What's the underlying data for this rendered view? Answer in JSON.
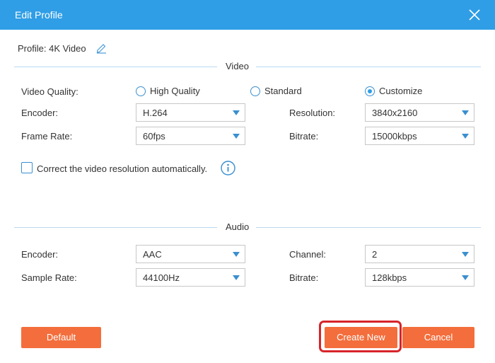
{
  "window": {
    "title": "Edit Profile"
  },
  "profile": {
    "label": "Profile:",
    "value": "4K Video"
  },
  "video": {
    "section_title": "Video",
    "quality_label": "Video Quality:",
    "quality_options": [
      {
        "label": "High Quality",
        "selected": false
      },
      {
        "label": "Standard",
        "selected": false
      },
      {
        "label": "Customize",
        "selected": true
      }
    ],
    "encoder_label": "Encoder:",
    "encoder_value": "H.264",
    "resolution_label": "Resolution:",
    "resolution_value": "3840x2160",
    "frame_rate_label": "Frame Rate:",
    "frame_rate_value": "60fps",
    "bitrate_label": "Bitrate:",
    "bitrate_value": "15000kbps",
    "auto_resolution_label": "Correct the video resolution automatically.",
    "auto_resolution_checked": false
  },
  "audio": {
    "section_title": "Audio",
    "encoder_label": "Encoder:",
    "encoder_value": "AAC",
    "channel_label": "Channel:",
    "channel_value": "2",
    "sample_rate_label": "Sample Rate:",
    "sample_rate_value": "44100Hz",
    "bitrate_label": "Bitrate:",
    "bitrate_value": "128kbps"
  },
  "buttons": {
    "default": "Default",
    "create_new": "Create New",
    "cancel": "Cancel"
  },
  "colors": {
    "titlebar": "#2f9ee6",
    "accent_button": "#f36e3c",
    "highlight_border": "#d7242a",
    "radio_accent": "#2f9ee6"
  }
}
